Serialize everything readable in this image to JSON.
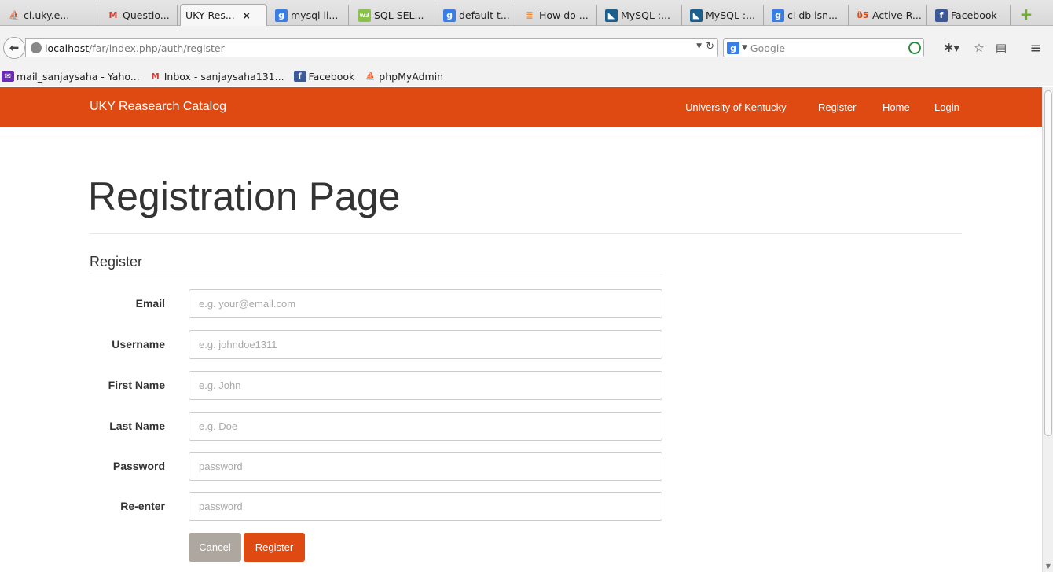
{
  "tabs": [
    {
      "label": "ci.uky.e...",
      "icon": "phpmyadmin-icon",
      "active": false
    },
    {
      "label": "Questio...",
      "icon": "gmail-icon",
      "active": false
    },
    {
      "label": "UKY Res...",
      "icon": "",
      "active": true,
      "close": "×"
    },
    {
      "label": "mysql li...",
      "icon": "google-icon",
      "active": false
    },
    {
      "label": "SQL SEL...",
      "icon": "w3schools-icon",
      "active": false
    },
    {
      "label": "default t...",
      "icon": "google-icon",
      "active": false
    },
    {
      "label": "How do ...",
      "icon": "stackoverflow-icon",
      "active": false
    },
    {
      "label": "MySQL :...",
      "icon": "mysql-icon",
      "active": false
    },
    {
      "label": "MySQL :...",
      "icon": "mysql-icon",
      "active": false
    },
    {
      "label": "ci db isn...",
      "icon": "google-icon",
      "active": false
    },
    {
      "label": "Active R...",
      "icon": "codeigniter-icon",
      "active": false
    },
    {
      "label": "Facebook",
      "icon": "facebook-icon",
      "active": false
    }
  ],
  "new_tab": "+",
  "urlbar": {
    "host": "localhost",
    "path": "/far/index.php/auth/register"
  },
  "searchbar": {
    "placeholder": "Google"
  },
  "bookmarks": [
    {
      "label": "mail_sanjaysaha - Yaho...",
      "icon": "yahoo-mail-icon"
    },
    {
      "label": "Inbox - sanjaysaha131...",
      "icon": "gmail-icon"
    },
    {
      "label": "Facebook",
      "icon": "facebook-icon"
    },
    {
      "label": "phpMyAdmin",
      "icon": "phpmyadmin-icon"
    }
  ],
  "site": {
    "brand": "UKY Reasearch Catalog",
    "nav": [
      "University of Kentucky",
      "Register",
      "Home",
      "Login"
    ],
    "title": "Registration Page",
    "legend": "Register"
  },
  "form": [
    {
      "label": "Email",
      "placeholder": "e.g. your@email.com"
    },
    {
      "label": "Username",
      "placeholder": "e.g. johndoe1311"
    },
    {
      "label": "First Name",
      "placeholder": "e.g. John"
    },
    {
      "label": "Last Name",
      "placeholder": "e.g. Doe"
    },
    {
      "label": "Password",
      "placeholder": "password"
    },
    {
      "label": "Re-enter",
      "placeholder": "password"
    }
  ],
  "buttons": {
    "cancel": "Cancel",
    "register": "Register"
  },
  "colors": {
    "brand_orange": "#df4a12",
    "cancel_gray": "#aea79f"
  }
}
